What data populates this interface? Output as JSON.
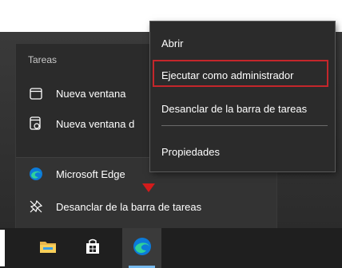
{
  "jumplist": {
    "section_title": "Tareas",
    "tasks": [
      {
        "label": "Nueva ventana",
        "icon": "window-icon"
      },
      {
        "label": "Nueva ventana d",
        "icon": "private-window-icon"
      }
    ],
    "pinned": [
      {
        "label": "Microsoft Edge",
        "icon": "edge-icon"
      },
      {
        "label": "Desanclar de la barra de tareas",
        "icon": "unpin-icon"
      }
    ]
  },
  "context_menu": {
    "items": [
      {
        "label": "Abrir"
      },
      {
        "label": "Ejecutar como administrador"
      },
      {
        "label": "Desanclar de la barra de tareas"
      },
      {
        "label": "Propiedades"
      }
    ],
    "highlighted_index": 1,
    "highlight_color": "#c4262b"
  },
  "taskbar": {
    "apps": [
      {
        "name": "file-explorer-icon"
      },
      {
        "name": "microsoft-store-icon"
      },
      {
        "name": "edge-icon",
        "active": true
      }
    ],
    "accent": "#76b9ed"
  },
  "marker_color": "#d31b1b"
}
